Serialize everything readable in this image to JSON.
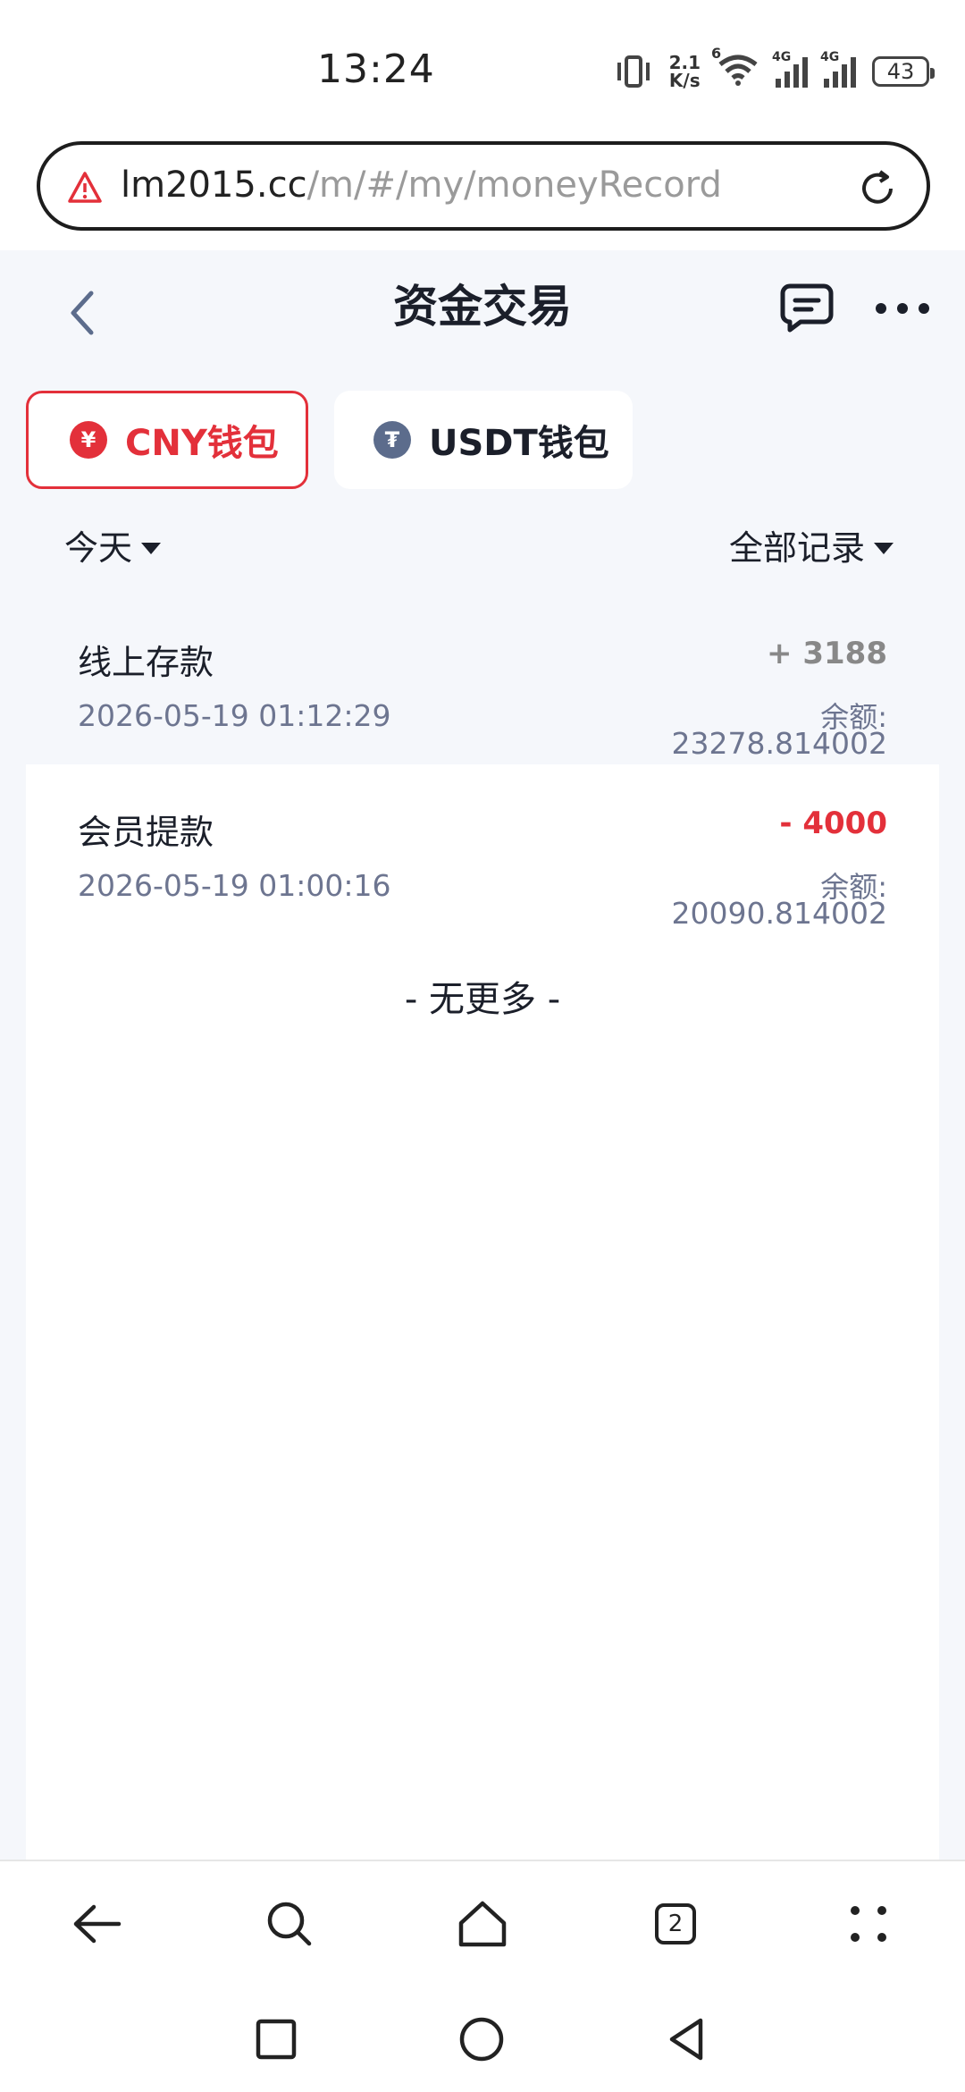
{
  "status_bar": {
    "time": "13:24",
    "net_speed_value": "2.1",
    "net_speed_unit": "K/s",
    "wifi_label": "6",
    "signal1_label": "4G",
    "signal2_label": "4G",
    "battery": "43"
  },
  "browser": {
    "url_host": "lm2015.cc",
    "url_path": "/m/#/my/moneyRecord",
    "tab_count": "2"
  },
  "header": {
    "title": "资金交易"
  },
  "wallets": [
    {
      "label": "CNY钱包",
      "icon_text": "¥",
      "active": true
    },
    {
      "label": "USDT钱包",
      "icon_text": "₮",
      "active": false
    }
  ],
  "filters": {
    "date": "今天",
    "type": "全部记录"
  },
  "records": [
    {
      "title": "线上存款",
      "datetime": "2026-05-19 01:12:29",
      "amount": "+ 3188",
      "balance_label": "余额:",
      "balance": "23278.814002"
    },
    {
      "title": "会员提款",
      "datetime": "2026-05-19 01:00:16",
      "amount": "- 4000",
      "balance_label": "余额:",
      "balance": "20090.814002"
    }
  ],
  "list_end_text": "- 无更多 -",
  "colors": {
    "accent_red": "#e3303a",
    "page_bg": "#f5f7fb",
    "secondary_text": "#6d7590"
  },
  "icons": [
    "warning-icon",
    "reload-icon",
    "back-arrow-icon",
    "chat-icon",
    "more-icon",
    "yuan-icon",
    "tether-icon",
    "search-icon",
    "home-icon",
    "menu-icon"
  ]
}
